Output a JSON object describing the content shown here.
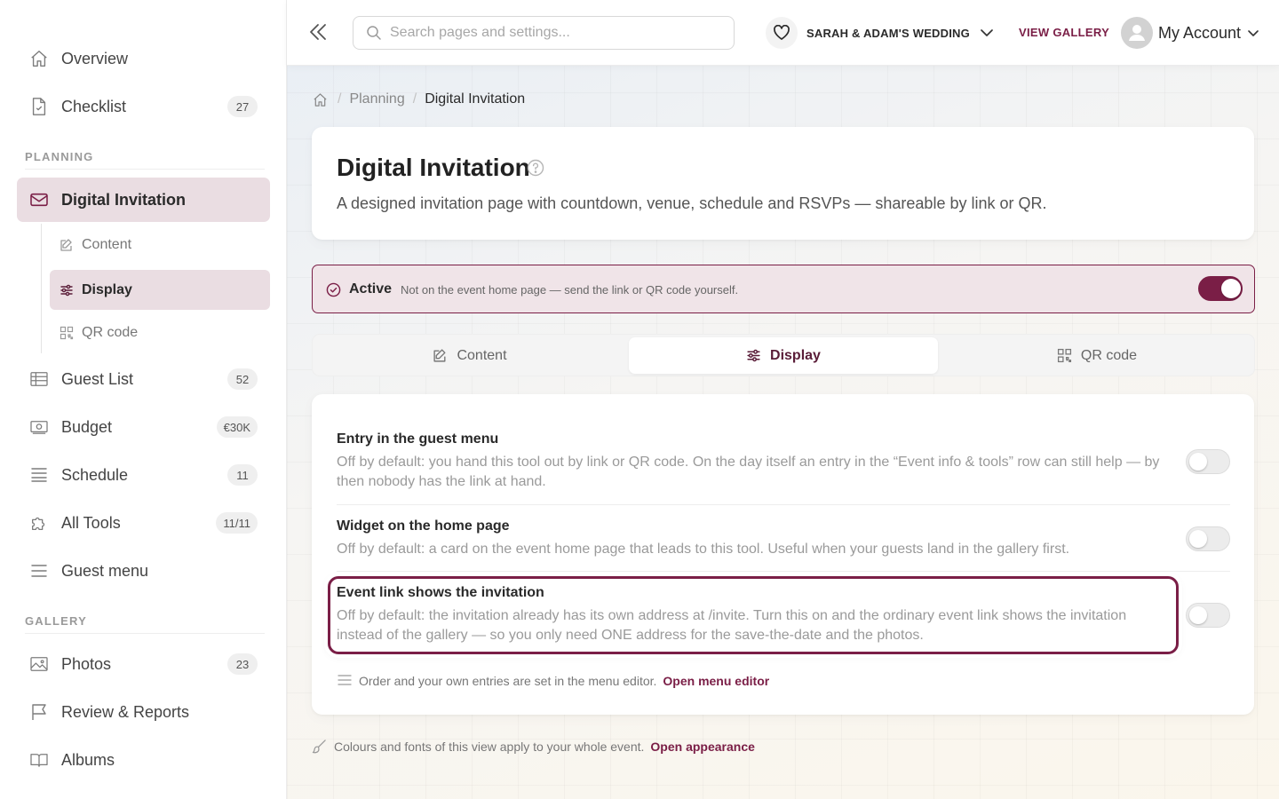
{
  "colors": {
    "accent": "#7a1e46",
    "accent_soft": "#eadde2",
    "banner_bg": "#f0e4e8"
  },
  "sidebar": {
    "top_items": [
      {
        "label": "Overview",
        "icon": "home-icon"
      },
      {
        "label": "Checklist",
        "icon": "checklist-icon",
        "badge": "27"
      }
    ],
    "planning_label": "PLANNING",
    "active_item": {
      "label": "Digital Invitation",
      "icon": "envelope-icon"
    },
    "sub_items": [
      {
        "label": "Content",
        "icon": "edit-icon"
      },
      {
        "label": "Display",
        "icon": "sliders-icon",
        "active": true
      },
      {
        "label": "QR code",
        "icon": "qr-icon"
      }
    ],
    "planning_items": [
      {
        "label": "Guest List",
        "icon": "table-icon",
        "badge": "52"
      },
      {
        "label": "Budget",
        "icon": "money-icon",
        "badge": "€30K"
      },
      {
        "label": "Schedule",
        "icon": "list-icon",
        "badge": "11"
      },
      {
        "label": "All Tools",
        "icon": "puzzle-icon",
        "badge": "11/11"
      },
      {
        "label": "Guest menu",
        "icon": "menu-icon"
      }
    ],
    "gallery_label": "GALLERY",
    "gallery_items": [
      {
        "label": "Photos",
        "icon": "image-icon",
        "badge": "23"
      },
      {
        "label": "Review & Reports",
        "icon": "flag-icon"
      },
      {
        "label": "Albums",
        "icon": "book-icon"
      }
    ]
  },
  "topbar": {
    "search_placeholder": "Search pages and settings...",
    "event_name": "SARAH & ADAM'S WEDDING",
    "view_gallery": "VIEW GALLERY",
    "account": "My Account"
  },
  "breadcrumb": {
    "parent": "Planning",
    "current": "Digital Invitation"
  },
  "header": {
    "title": "Digital Invitation",
    "description": "A designed invitation page with countdown, venue, schedule and RSVPs — shareable by link or QR."
  },
  "banner": {
    "status": "Active",
    "description": "Not on the event home page — send the link or QR code yourself.",
    "toggle_on": true
  },
  "tabs": [
    {
      "label": "Content",
      "icon": "edit-icon"
    },
    {
      "label": "Display",
      "icon": "sliders-icon",
      "active": true
    },
    {
      "label": "QR code",
      "icon": "qr-icon"
    }
  ],
  "settings": [
    {
      "title": "Entry in the guest menu",
      "description": "Off by default: you hand this tool out by link or QR code. On the day itself an entry in the “Event info & tools” row can still help — by then nobody has the link at hand.",
      "enabled": false
    },
    {
      "title": "Widget on the home page",
      "description": "Off by default: a card on the event home page that leads to this tool. Useful when your guests land in the gallery first.",
      "enabled": false
    },
    {
      "title": "Event link shows the invitation",
      "description": "Off by default: the invitation already has its own address at /invite. Turn this on and the ordinary event link shows the invitation instead of the gallery — so you only need ONE address for the save-the-date and the photos.",
      "enabled": false,
      "highlighted": true
    }
  ],
  "menu_note": {
    "text": "Order and your own entries are set in the menu editor.",
    "link": "Open menu editor"
  },
  "footer_note": {
    "text": "Colours and fonts of this view apply to your whole event.",
    "link": "Open appearance"
  }
}
